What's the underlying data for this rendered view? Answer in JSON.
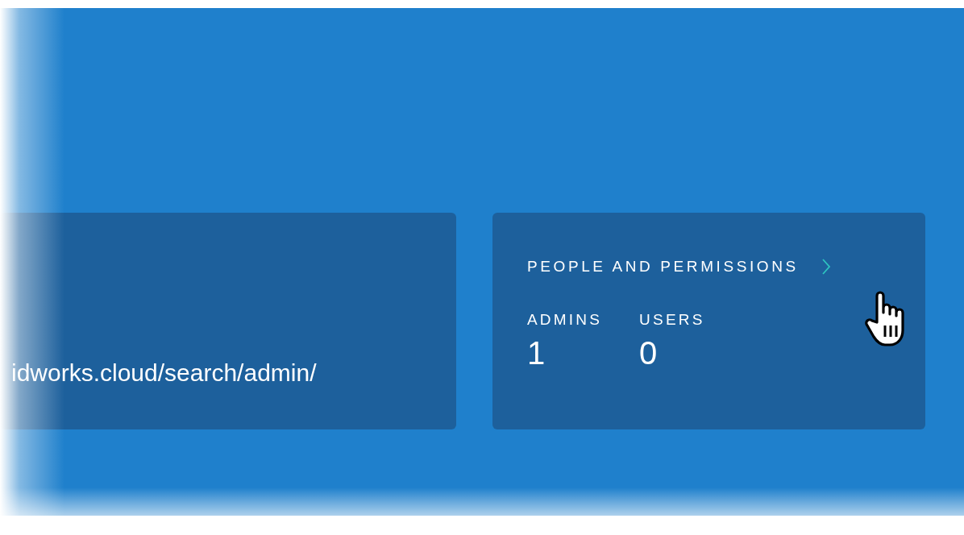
{
  "url_card": {
    "text": "idworks.cloud/search/admin/"
  },
  "people_card": {
    "title": "PEOPLE AND PERMISSIONS",
    "stats": [
      {
        "label": "ADMINS",
        "value": "1"
      },
      {
        "label": "USERS",
        "value": "0"
      }
    ]
  }
}
